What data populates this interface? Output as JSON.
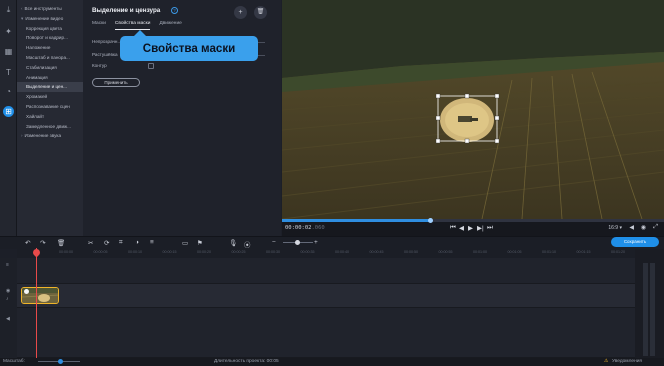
{
  "rail": {
    "icons": [
      "import-icon",
      "wand-icon",
      "transitions-icon",
      "text-icon",
      "stickers-icon",
      "more-tools-icon"
    ]
  },
  "tree": {
    "items": [
      {
        "label": "Все инструменты",
        "type": "parent",
        "caret": "‹"
      },
      {
        "label": "Изменение видео",
        "type": "parent",
        "caret": "▾"
      },
      {
        "label": "Коррекция цвета",
        "type": "child"
      },
      {
        "label": "Поворот и кадрир...",
        "type": "child"
      },
      {
        "label": "Наложение",
        "type": "child"
      },
      {
        "label": "Масштаб и панора...",
        "type": "child"
      },
      {
        "label": "Стабилизация",
        "type": "child"
      },
      {
        "label": "Анимация",
        "type": "child"
      },
      {
        "label": "Выделение и цен...",
        "type": "child",
        "selected": true
      },
      {
        "label": "Хромакей",
        "type": "child"
      },
      {
        "label": "Распознавание сцен",
        "type": "child"
      },
      {
        "label": "Хайлайт",
        "type": "child"
      },
      {
        "label": "Замедленное движ...",
        "type": "child"
      },
      {
        "label": "Изменение звука",
        "type": "parent",
        "caret": "›"
      }
    ]
  },
  "props": {
    "title": "Выделение и цензура",
    "help": "?",
    "add": "+",
    "delete": "🗑",
    "tabs": [
      "Маски",
      "Свойства маски",
      "Движение"
    ],
    "active_tab": 1,
    "row1": "Непрозрачн...",
    "row2": "Растушёвка",
    "row3": "Контур",
    "apply_label": "Применить"
  },
  "tooltip": "Свойства маски",
  "player": {
    "time_current": "00:00:02",
    "time_rest": ".060",
    "progress": 0.39,
    "ratio": "16:9 ▾",
    "controls": [
      "⏮",
      "◀",
      "▶",
      "▶|",
      "⏭"
    ]
  },
  "timeline": {
    "export_label": "Сохранить",
    "ruler_ticks": [
      "00:00:00",
      "00:00:05",
      "00:00:10",
      "00:00:15",
      "00:00:20",
      "00:00:25",
      "00:00:30",
      "00:00:35",
      "00:00:40",
      "00:00:45",
      "00:00:50",
      "00:00:55",
      "00:01:00",
      "00:01:05",
      "00:01:10",
      "00:01:15",
      "00:01:20",
      "00:01:25"
    ]
  },
  "status": {
    "scale_label": "Масштаб:",
    "duration_label": "Длительность проекта: 00:05",
    "notifications_label": "Уведомления"
  },
  "colors": {
    "accent": "#1f8fe8",
    "clip_border": "#f0b429",
    "playhead": "#e84a4a"
  }
}
